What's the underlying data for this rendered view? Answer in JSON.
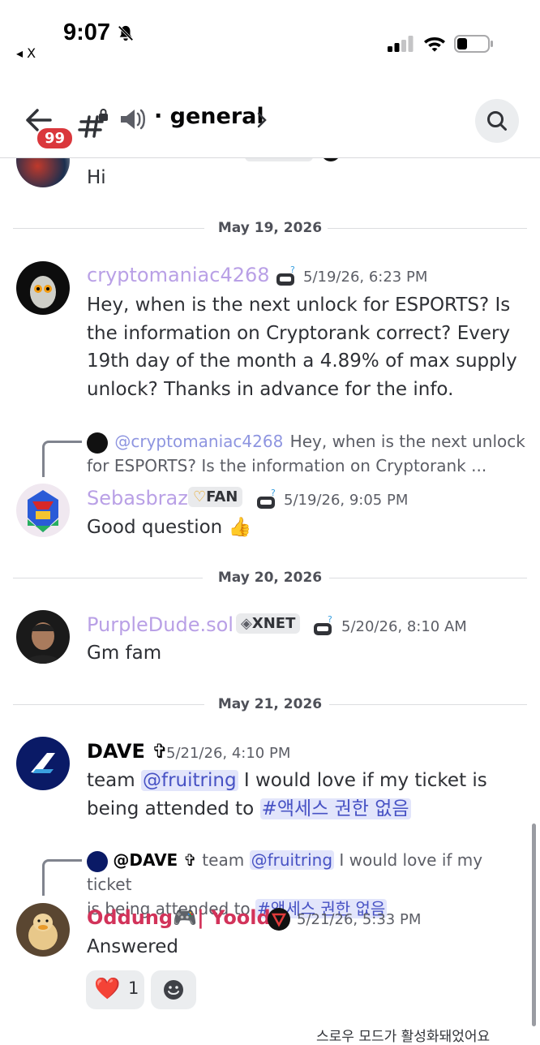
{
  "status_bar": {
    "time": "9:07",
    "back_app": "◂ X"
  },
  "header": {
    "badge": "99",
    "channel": "· general"
  },
  "messages": {
    "partial_first": {
      "text": "Hi"
    },
    "divider1": "May 19, 2026",
    "m1": {
      "username": "cryptomaniac4268",
      "timestamp": "5/19/26, 6:23 PM",
      "text": "Hey, when is the next unlock for ESPORTS? Is the information on Cryptorank correct? Every 19th day of the month a 4.89% of max supply unlock? Thanks in advance for the info."
    },
    "m2": {
      "reply_mention": "@cryptomaniac4268",
      "reply_text_1": " Hey, when is the next unlock",
      "reply_text_2": "for ESPORTS? Is the information on Cryptorank ...",
      "username": "Sebasbraz",
      "tag": "FAN",
      "timestamp": "5/19/26, 9:05 PM",
      "text": "Good question 👍"
    },
    "divider2": "May 20, 2026",
    "m3": {
      "username": "PurpleDude.sol",
      "tag": "XNET",
      "timestamp": "5/20/26, 8:10 AM",
      "text": "Gm fam"
    },
    "divider3": "May 21, 2026",
    "m4": {
      "username": "DAVE ✞",
      "timestamp": "5/21/26, 4:10 PM",
      "text_1": "team ",
      "mention": "@fruitring",
      "text_2": " I would love if my ticket is being attended to ",
      "channel_mention": "액세스 권한 없음"
    },
    "m5": {
      "reply_user": "@DAVE ✞",
      "reply_pre": " team ",
      "reply_mention": "@fruitring",
      "reply_text_1": " I would love if my ticket",
      "reply_text_2": "is being attended to ",
      "reply_channel": "액세스 권한 없음",
      "username_1": "Oddung",
      "username_emoji": "🎮",
      "username_2": "| Yooldo",
      "timestamp": "5/21/26, 5:33 PM",
      "text": "Answered",
      "reaction_emoji": "❤️",
      "reaction_count": "1"
    }
  },
  "toast": "스로우 모드가 활성화돼었어요",
  "colors": {
    "username_purple": "#b9a0e6",
    "username_red": "#d2335a",
    "mention_bg": "#e2e5fb",
    "mention_fg": "#4752c4",
    "badge_red": "#da373c"
  }
}
